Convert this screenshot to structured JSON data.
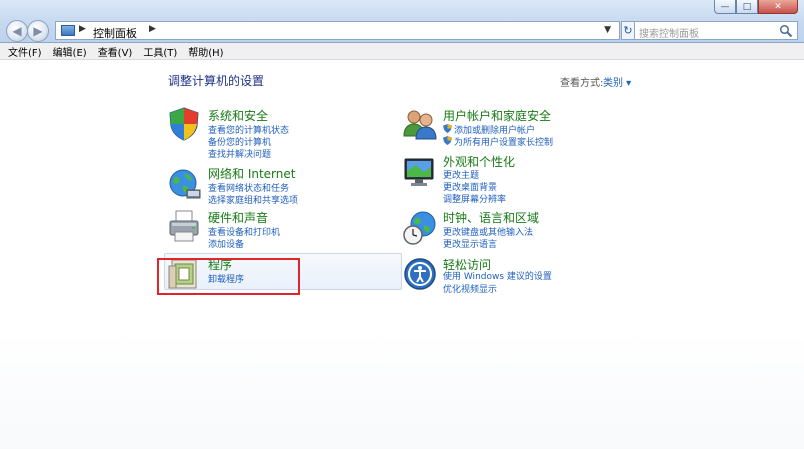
{
  "window": {
    "breadcrumb": [
      "控制面板"
    ],
    "search_placeholder": "搜索控制面板",
    "buttons": {
      "minimize": "—",
      "maximize": "□",
      "close": "✕"
    }
  },
  "menu": [
    "文件(F)",
    "编辑(E)",
    "查看(V)",
    "工具(T)",
    "帮助(H)"
  ],
  "page": {
    "title": "调整计算机的设置",
    "view_by_label": "查看方式:",
    "view_by_value": "类别 ▾"
  },
  "categories": [
    {
      "title": "系统和安全",
      "links": [
        "查看您的计算机状态",
        "备份您的计算机",
        "查找并解决问题"
      ],
      "icon": "shield-icon"
    },
    {
      "title": "网络和 Internet",
      "links": [
        "查看网络状态和任务",
        "选择家庭组和共享选项"
      ],
      "icon": "network-globe-icon"
    },
    {
      "title": "硬件和声音",
      "links": [
        "查看设备和打印机",
        "添加设备"
      ],
      "icon": "printer-icon"
    },
    {
      "title": "程序",
      "links": [
        "卸载程序"
      ],
      "icon": "programs-icon"
    },
    {
      "title": "用户帐户和家庭安全",
      "links": [
        "添加或删除用户帐户",
        "为所有用户设置家长控制"
      ],
      "icon": "users-icon"
    },
    {
      "title": "外观和个性化",
      "links": [
        "更改主题",
        "更改桌面背景",
        "调整屏幕分辨率"
      ],
      "icon": "monitor-appearance-icon"
    },
    {
      "title": "时钟、语言和区域",
      "links": [
        "更改键盘或其他输入法",
        "更改显示语言"
      ],
      "icon": "clock-globe-icon"
    },
    {
      "title": "轻松访问",
      "links": [
        "使用 Windows 建议的设置",
        "优化视频显示"
      ],
      "icon": "ease-of-access-icon"
    }
  ],
  "colors": {
    "link": "#1f5fbf",
    "category_title": "#177a16",
    "highlight": "#e0262c"
  }
}
